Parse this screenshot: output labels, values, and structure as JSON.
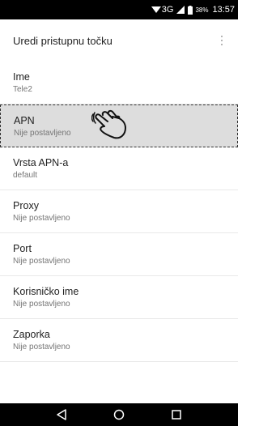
{
  "status_bar": {
    "network": "3G",
    "battery": "38%",
    "time": "13:57",
    "icons": [
      "wifi-icon",
      "signal-icon",
      "battery-icon"
    ]
  },
  "toolbar": {
    "title": "Uredi pristupnu točku",
    "menu_icon": "overflow-menu-icon"
  },
  "items": [
    {
      "title": "Ime",
      "value": "Tele2"
    },
    {
      "title": "APN",
      "value": "Nije postavljeno"
    },
    {
      "title": "Vrsta APN-a",
      "value": "default"
    },
    {
      "title": "Proxy",
      "value": "Nije postavljeno"
    },
    {
      "title": "Port",
      "value": "Nije postavljeno"
    },
    {
      "title": "Korisničko ime",
      "value": "Nije postavljeno"
    },
    {
      "title": "Zaporka",
      "value": "Nije postavljeno"
    }
  ],
  "highlighted_item": "APN",
  "navigation": [
    "back-icon",
    "home-icon",
    "recents-icon"
  ]
}
